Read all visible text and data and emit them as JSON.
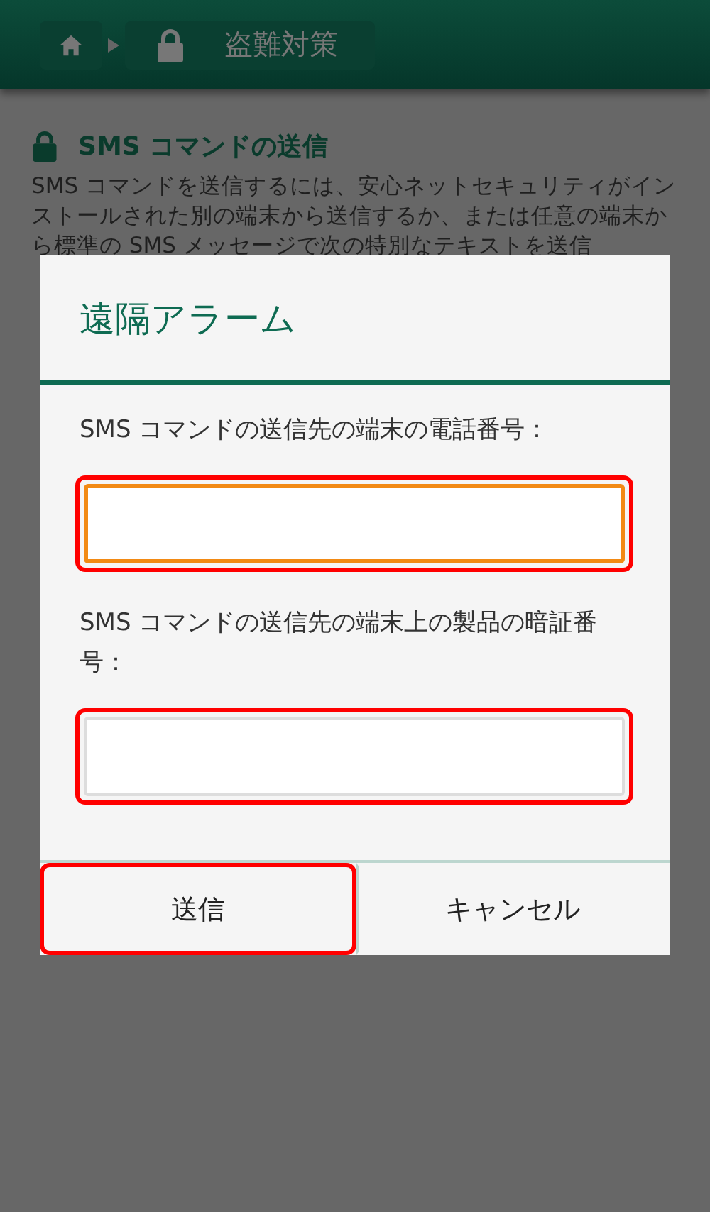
{
  "breadcrumb": {
    "current": "盗難対策"
  },
  "section": {
    "title": "SMS コマンドの送信",
    "body": "SMS コマンドを送信するには、安心ネットセキュリティがインストールされた別の端末から送信するか、または任意の端末から標準の SMS メッセージで次の特別なテキストを送信"
  },
  "dialog": {
    "title": "遠隔アラーム",
    "fields": [
      {
        "label": "SMS コマンドの送信先の端末の電話番号：",
        "focused": true,
        "highlighted": true
      },
      {
        "label": "SMS コマンドの送信先の端末上の製品の暗証番号：",
        "focused": false,
        "highlighted": true
      }
    ],
    "buttons": [
      {
        "label": "送信",
        "highlighted": true
      },
      {
        "label": "キャンセル",
        "highlighted": false
      }
    ]
  }
}
